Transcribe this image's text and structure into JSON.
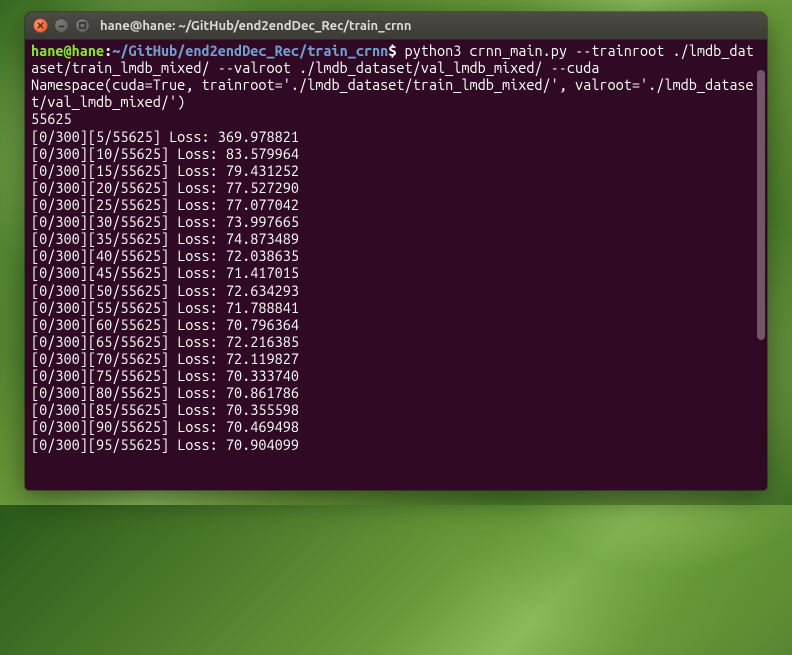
{
  "titlebar": {
    "title": "hane@hane: ~/GitHub/end2endDec_Rec/train_crnn"
  },
  "prompt": {
    "user_host": "hane@hane",
    "sep1": ":",
    "path": "~/GitHub/end2endDec_Rec/train_crnn",
    "sep2": "$"
  },
  "command": " python3 crnn_main.py --trainroot ./lmdb_dataset/train_lmdb_mixed/ --valroot ./lmdb_dataset/val_lmdb_mixed/ --cuda",
  "output": {
    "namespace": "Namespace(cuda=True, trainroot='./lmdb_dataset/train_lmdb_mixed/', valroot='./lmdb_dataset/val_lmdb_mixed/')",
    "count": "55625",
    "losses": [
      "[0/300][5/55625] Loss: 369.978821",
      "[0/300][10/55625] Loss: 83.579964",
      "[0/300][15/55625] Loss: 79.431252",
      "[0/300][20/55625] Loss: 77.527290",
      "[0/300][25/55625] Loss: 77.077042",
      "[0/300][30/55625] Loss: 73.997665",
      "[0/300][35/55625] Loss: 74.873489",
      "[0/300][40/55625] Loss: 72.038635",
      "[0/300][45/55625] Loss: 71.417015",
      "[0/300][50/55625] Loss: 72.634293",
      "[0/300][55/55625] Loss: 71.788841",
      "[0/300][60/55625] Loss: 70.796364",
      "[0/300][65/55625] Loss: 72.216385",
      "[0/300][70/55625] Loss: 72.119827",
      "[0/300][75/55625] Loss: 70.333740",
      "[0/300][80/55625] Loss: 70.861786",
      "[0/300][85/55625] Loss: 70.355598",
      "[0/300][90/55625] Loss: 70.469498",
      "[0/300][95/55625] Loss: 70.904099"
    ]
  }
}
